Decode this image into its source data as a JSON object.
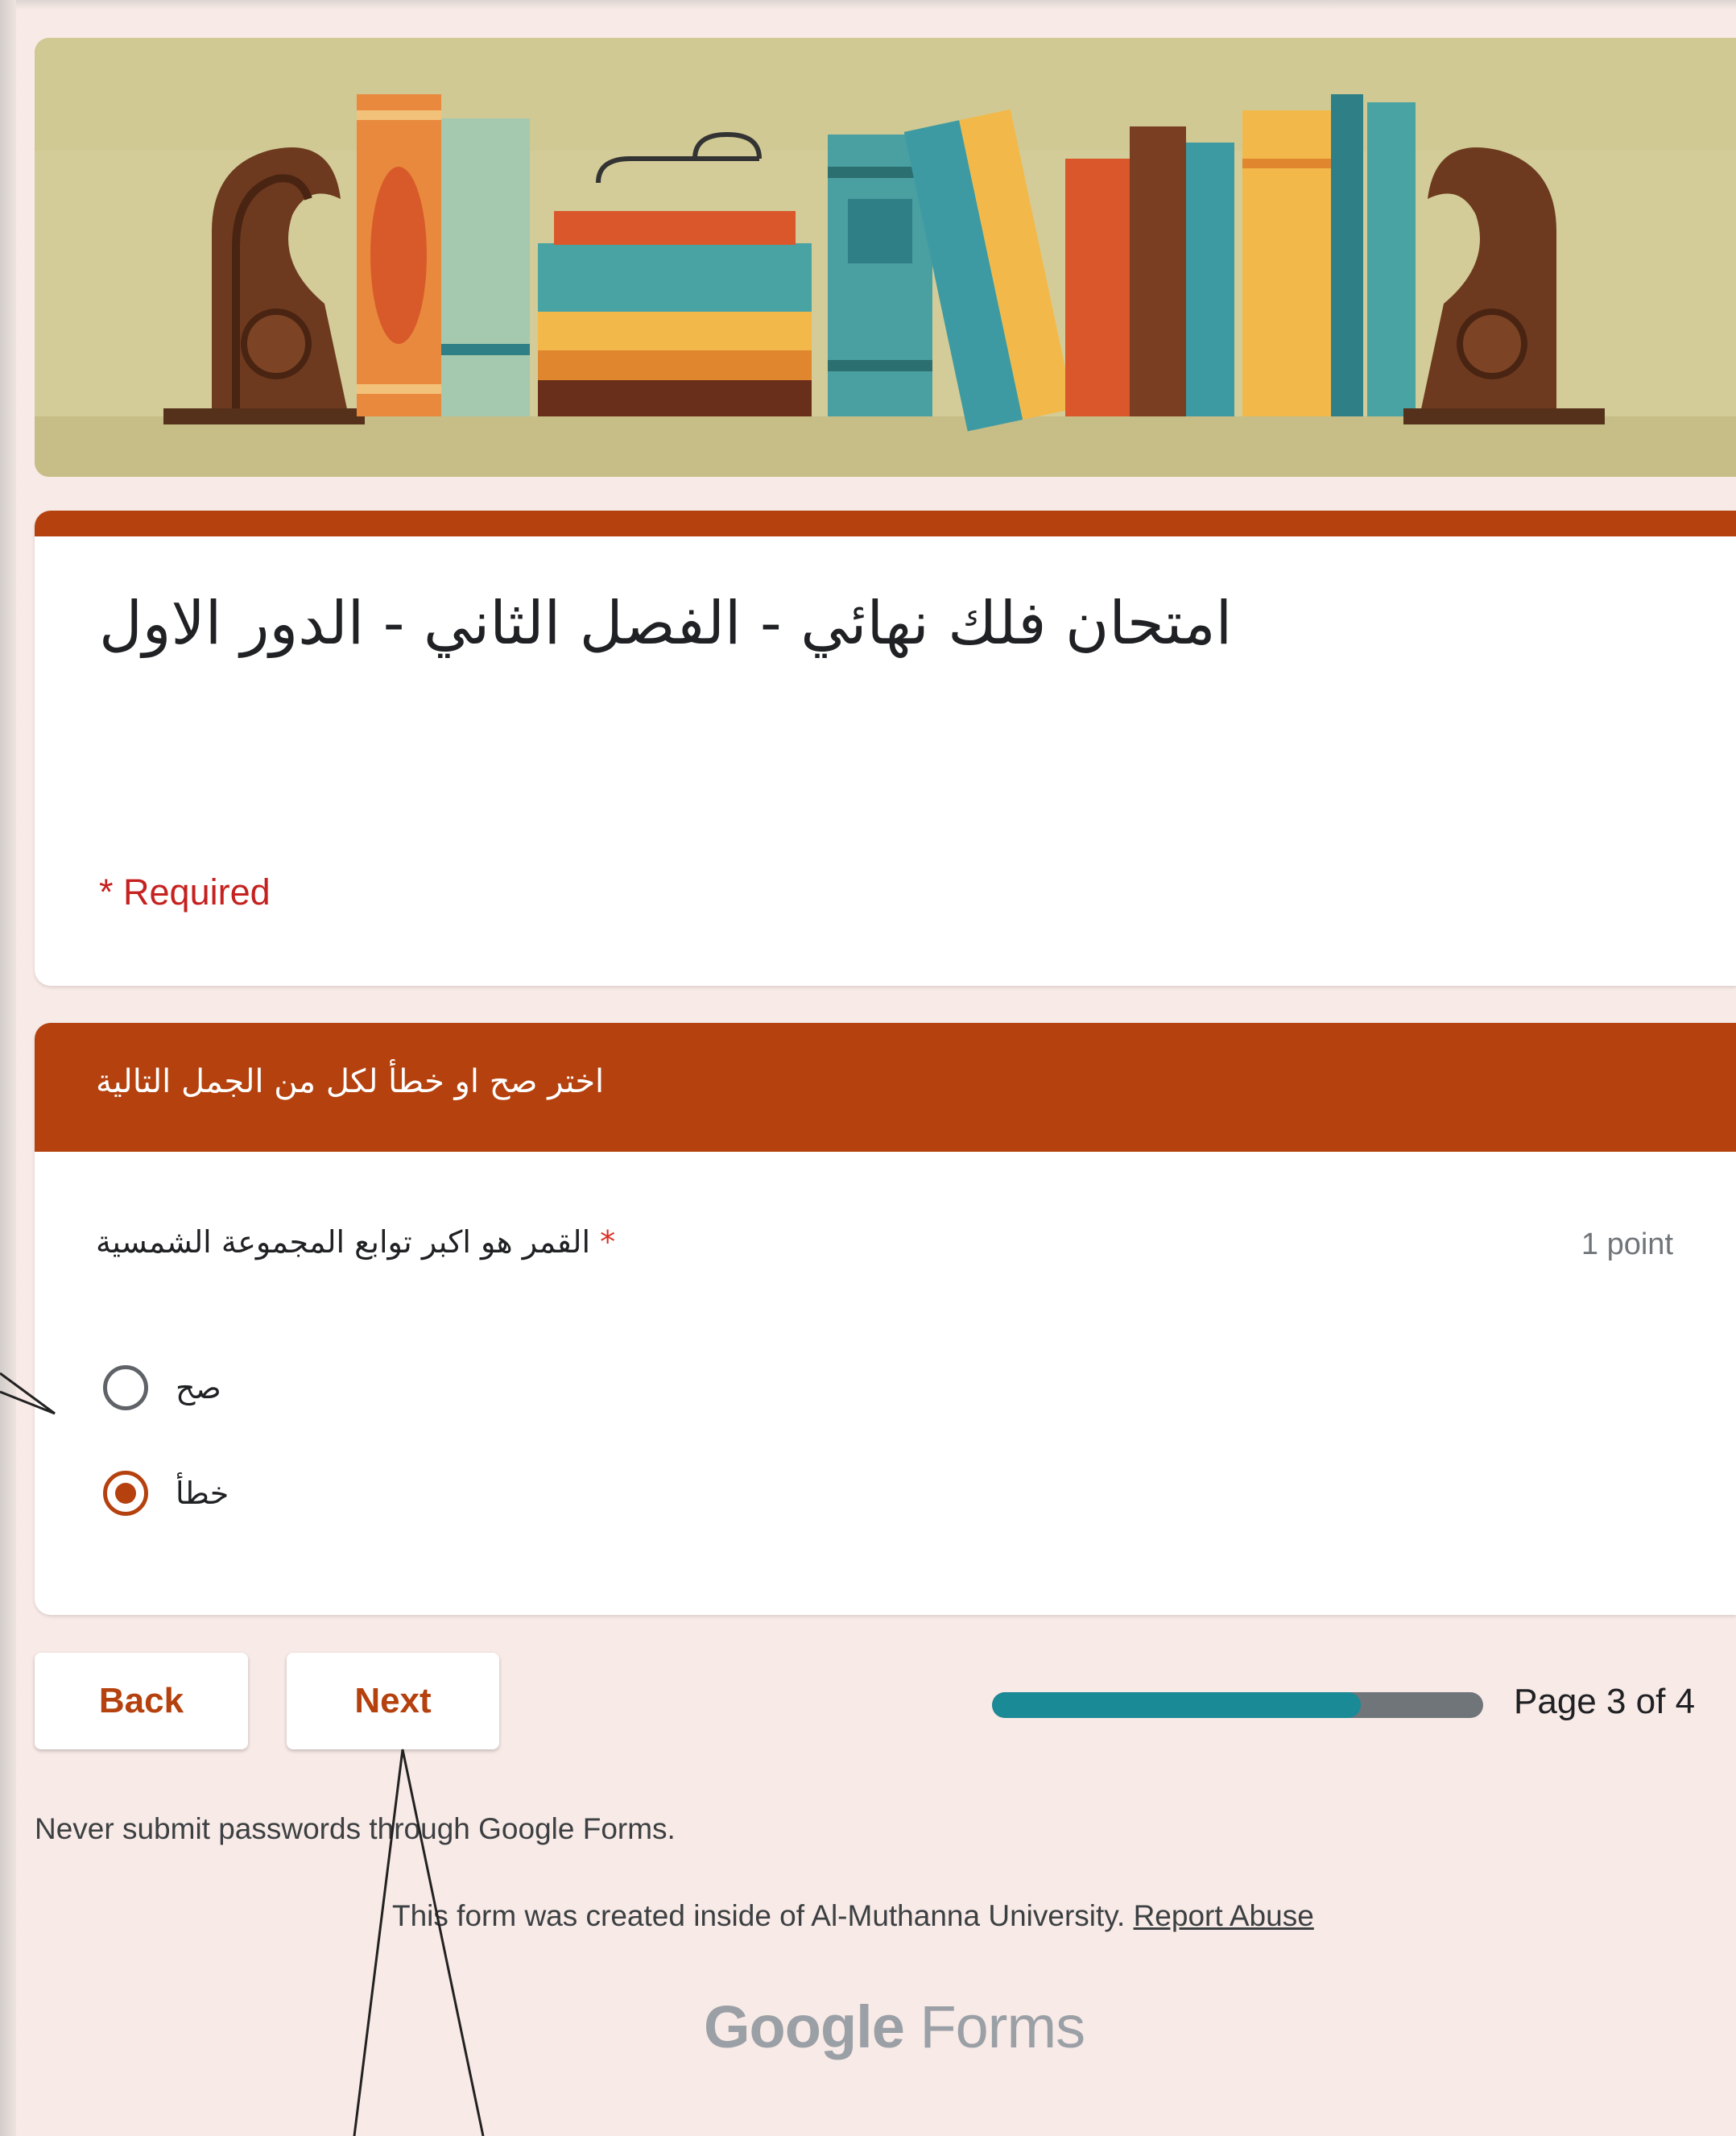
{
  "form": {
    "title": "امتحان فلك نهائي - الفصل الثاني - الدور الاول",
    "required_note": "* Required"
  },
  "section": {
    "title": "اختر صح او خطأ لكل من الجمل التالية"
  },
  "question": {
    "star": "*",
    "text": "القمر هو اكبر توابع المجموعة الشمسية",
    "points": "1 point",
    "options": [
      {
        "label": "صح",
        "selected": false
      },
      {
        "label": "خطأ",
        "selected": true
      }
    ]
  },
  "navigation": {
    "back_label": "Back",
    "next_label": "Next",
    "progress_fraction": 0.75,
    "page_indicator": "Page 3 of 4"
  },
  "footer": {
    "password_warning": "Never submit passwords through Google Forms.",
    "created_note": "This form was created inside of Al-Muthanna University.",
    "report_link": "Report Abuse",
    "logo_google": "Google",
    "logo_forms": "Forms"
  },
  "colors": {
    "accent": "#b4410e",
    "background": "#f8eae6",
    "progress": "#1a8a96",
    "required": "#c5221f"
  },
  "icons": [
    "radio-unchecked-icon",
    "radio-checked-icon"
  ]
}
